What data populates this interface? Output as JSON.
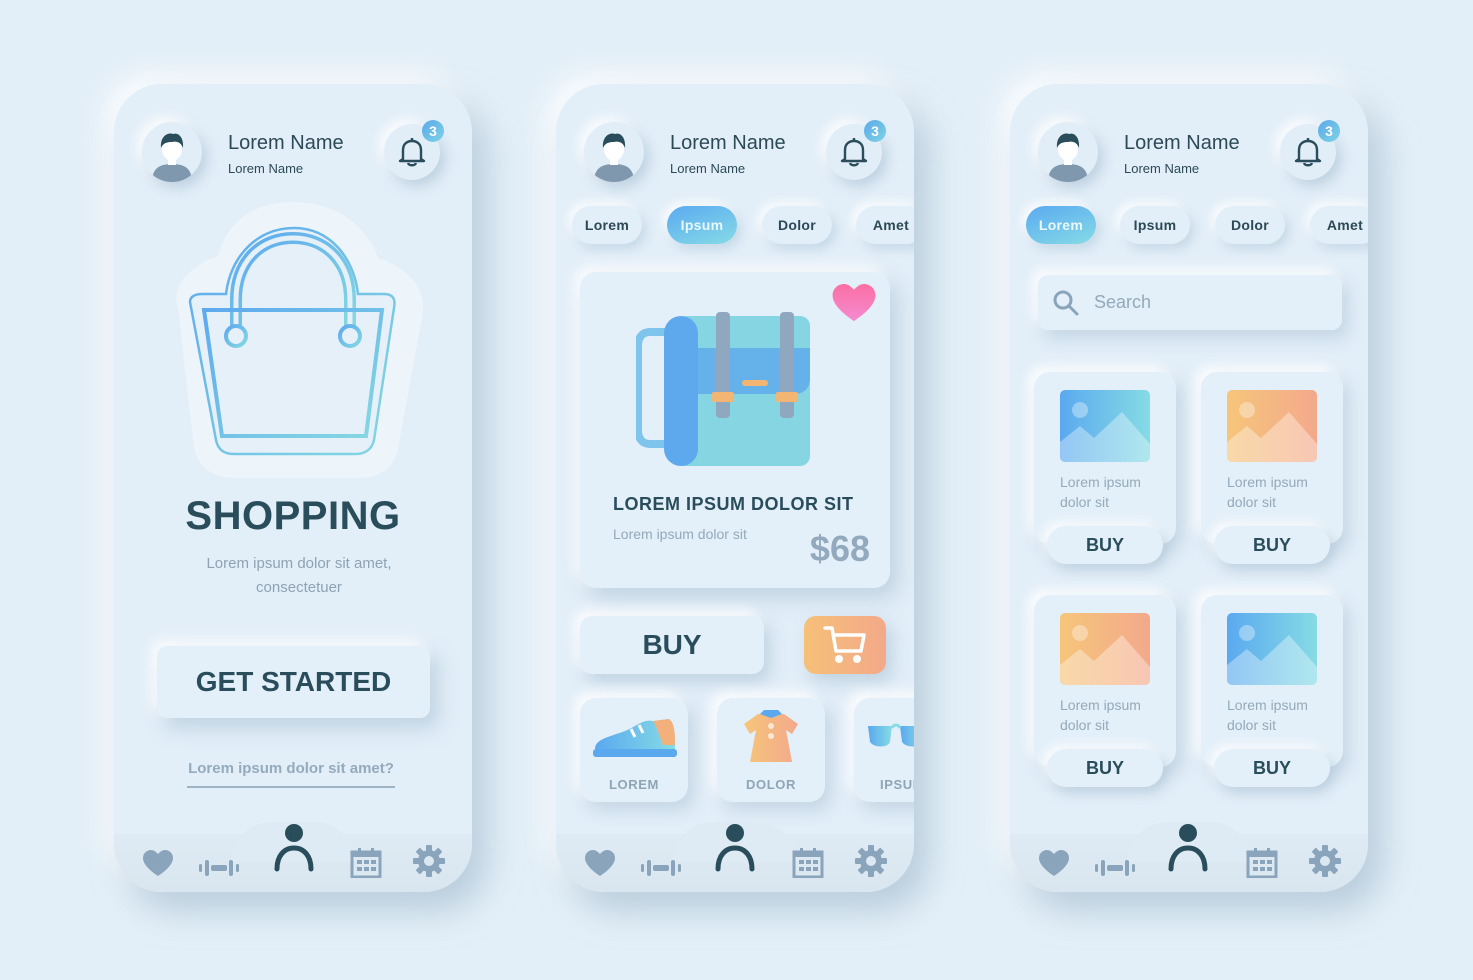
{
  "colors": {
    "background": "#e3eff8",
    "text_dark": "#2a4d5c",
    "text_muted": "#94a9b9",
    "accent_blue": "#5aaaf0",
    "accent_teal": "#86dbe6",
    "accent_orange": "#f6c078",
    "favorite_pink": "#f472b6"
  },
  "header": {
    "name": "Lorem Name",
    "subtitle": "Lorem Name",
    "notification_count": "3",
    "avatar_icon": "user-avatar-icon",
    "bell_icon": "bell-icon"
  },
  "screen1": {
    "hero_icon": "shopping-bag-icon",
    "title": "SHOPPING",
    "subtitle": "Lorem ipsum dolor sit amet, consectetuer",
    "cta_label": "GET STARTED",
    "link_label": "Lorem ipsum dolor sit amet?"
  },
  "screen2": {
    "chips": [
      {
        "label": "Lorem",
        "active": false
      },
      {
        "label": "Ipsum",
        "active": true
      },
      {
        "label": "Dolor",
        "active": false
      },
      {
        "label": "Amet",
        "active": false
      }
    ],
    "product": {
      "title": "LOREM IPSUM DOLOR SIT",
      "description": "Lorem ipsum dolor sit",
      "price": "$68",
      "favorite_icon": "heart-icon",
      "image_icon": "backpack-icon"
    },
    "buy_label": "BUY",
    "cart_icon": "cart-icon",
    "categories": [
      {
        "label": "LOREM",
        "icon": "sneaker-icon"
      },
      {
        "label": "DOLOR",
        "icon": "dress-icon"
      },
      {
        "label": "IPSUM",
        "icon": "sunglasses-icon"
      }
    ]
  },
  "screen3": {
    "chips": [
      {
        "label": "Lorem",
        "active": true
      },
      {
        "label": "Ipsum",
        "active": false
      },
      {
        "label": "Dolor",
        "active": false
      },
      {
        "label": "Amet",
        "active": false
      }
    ],
    "search_placeholder": "Search",
    "products": [
      {
        "text": "Lorem ipsum dolor sit",
        "buy_label": "BUY",
        "image_tone": "blue"
      },
      {
        "text": "Lorem ipsum dolor sit",
        "buy_label": "BUY",
        "image_tone": "orange"
      },
      {
        "text": "Lorem ipsum dolor sit",
        "buy_label": "BUY",
        "image_tone": "orange"
      },
      {
        "text": "Lorem ipsum dolor sit",
        "buy_label": "BUY",
        "image_tone": "blue"
      }
    ]
  },
  "bottom_nav": {
    "items": [
      {
        "icon": "heart-icon",
        "active": false
      },
      {
        "icon": "dumbbell-icon",
        "active": false
      },
      {
        "icon": "profile-icon",
        "active": true
      },
      {
        "icon": "calendar-icon",
        "active": false
      },
      {
        "icon": "settings-gear-icon",
        "active": false
      }
    ]
  }
}
